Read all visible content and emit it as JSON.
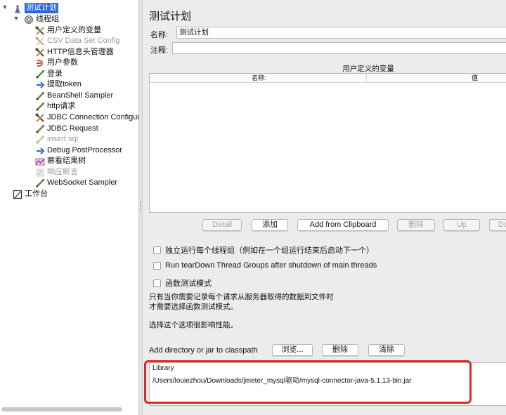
{
  "tree": {
    "items": [
      {
        "label": "测试计划",
        "icon": "test-plan-icon",
        "selected": true,
        "disabled": false
      },
      {
        "label": "线程组",
        "icon": "thread-group-icon",
        "selected": false,
        "disabled": false
      },
      {
        "label": "用户定义的变量",
        "icon": "wrench-icon",
        "selected": false,
        "disabled": false
      },
      {
        "label": "CSV Data Set Config",
        "icon": "wrench-icon",
        "selected": false,
        "disabled": true
      },
      {
        "label": "HTTP信息头管理器",
        "icon": "wrench-icon",
        "selected": false,
        "disabled": false
      },
      {
        "label": "用户参数",
        "icon": "pre-processor-icon",
        "selected": false,
        "disabled": false
      },
      {
        "label": "登录",
        "icon": "sampler-icon",
        "selected": false,
        "disabled": false
      },
      {
        "label": "提取token",
        "icon": "post-processor-icon",
        "selected": false,
        "disabled": false
      },
      {
        "label": "BeanShell Sampler",
        "icon": "sampler-icon",
        "selected": false,
        "disabled": false
      },
      {
        "label": "http请求",
        "icon": "sampler-icon",
        "selected": false,
        "disabled": false
      },
      {
        "label": "JDBC Connection Configura",
        "icon": "wrench-icon",
        "selected": false,
        "disabled": false
      },
      {
        "label": "JDBC Request",
        "icon": "sampler-icon",
        "selected": false,
        "disabled": false
      },
      {
        "label": "insert sql",
        "icon": "sampler-icon",
        "selected": false,
        "disabled": true
      },
      {
        "label": "Debug PostProcessor",
        "icon": "post-processor-icon",
        "selected": false,
        "disabled": false
      },
      {
        "label": "察看结果树",
        "icon": "listener-icon",
        "selected": false,
        "disabled": false
      },
      {
        "label": "响应断言",
        "icon": "assertion-icon",
        "selected": false,
        "disabled": true
      },
      {
        "label": "WebSocket Sampler",
        "icon": "sampler-icon",
        "selected": false,
        "disabled": false
      },
      {
        "label": "工作台",
        "icon": "workbench-icon",
        "selected": false,
        "disabled": false
      }
    ]
  },
  "panel": {
    "title": "测试计划",
    "name_label": "名称:",
    "name_value": "测试计划",
    "comment_label": "注释:",
    "comment_value": "",
    "vars_title": "用户定义的变量",
    "col_name": "名称:",
    "col_value": "值",
    "buttons": {
      "detail": "Detail",
      "add": "添加",
      "add_clipboard": "Add from Clipboard",
      "delete": "删除",
      "up": "Up",
      "down": "Do"
    },
    "checkboxes": {
      "serialize": "独立运行每个线程组（例如在一个组运行结束后启动下一个）",
      "teardown": "Run tearDown Thread Groups after shutdown of main threads",
      "functional": "函数测试模式"
    },
    "note_line1": "只有当你需要记录每个请求从服务器取得的数据到文件时",
    "note_line2": "才需要选择函数测试模式。",
    "note_line3": "选择这个选项很影响性能。",
    "classpath_label": "Add directory or jar to classpath",
    "classpath_buttons": {
      "browse": "浏览...",
      "delete": "删除",
      "clear": "清除"
    },
    "library_header": "Library",
    "library_path": "/Users/louiezhou/Downloads/jmeter_mysql驱动/mysql-connector-java-5.1.13-bin.jar"
  },
  "colors": {
    "selection": "#2e66d8",
    "highlight": "#e0262b"
  }
}
